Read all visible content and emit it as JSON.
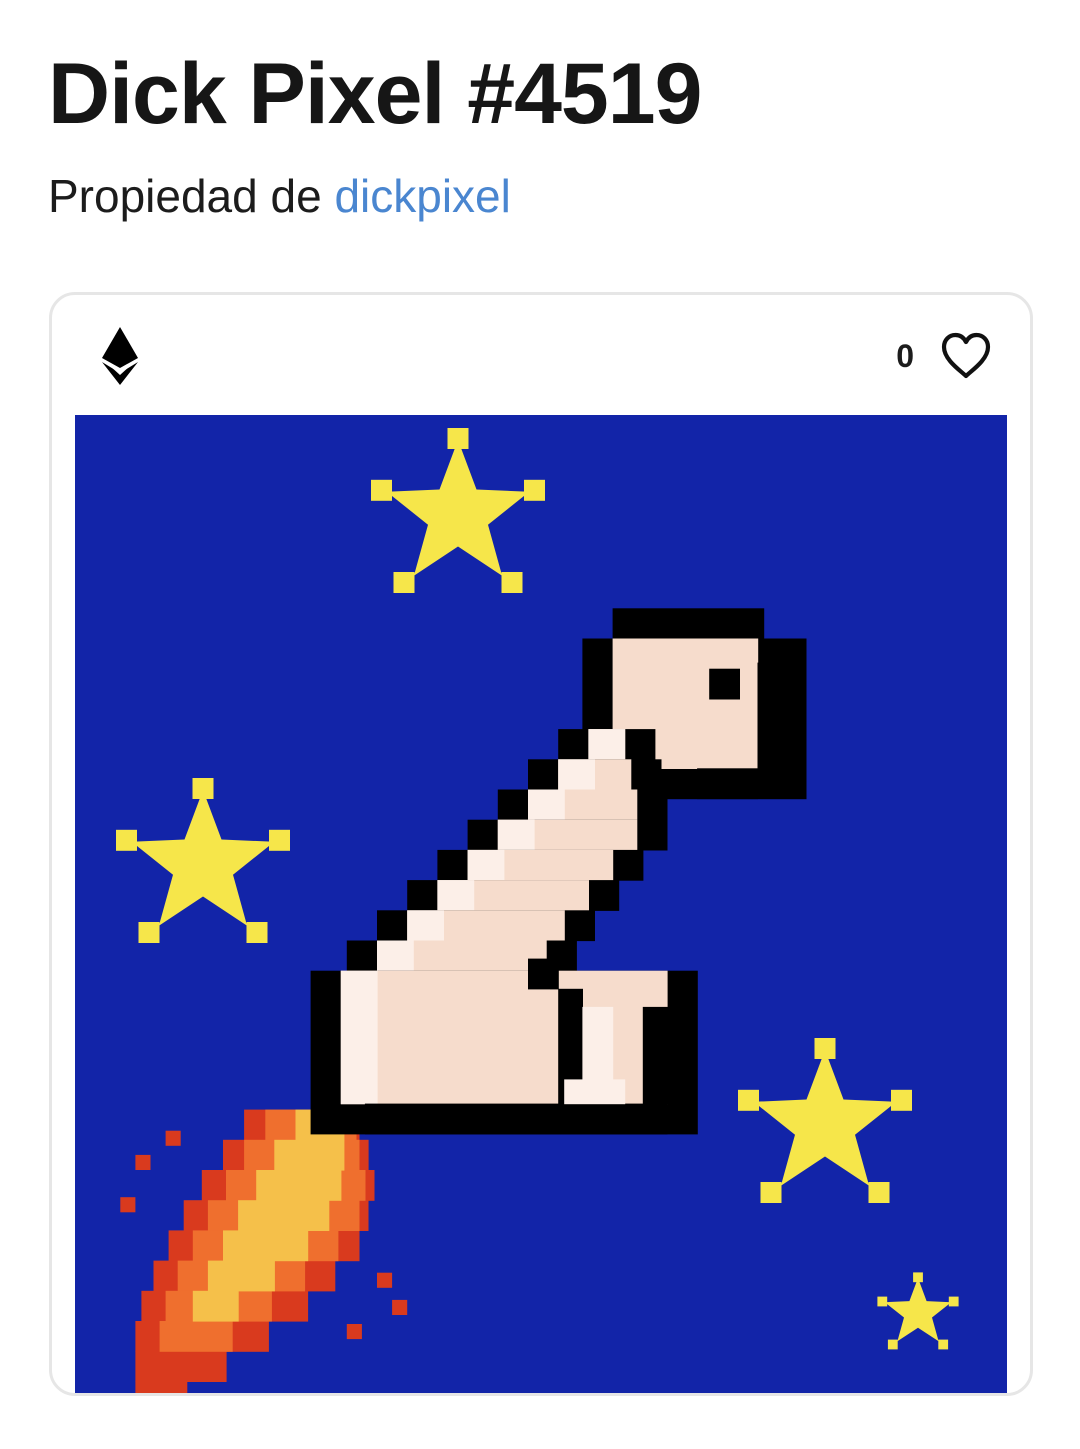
{
  "item": {
    "title": "Dick Pixel #4519",
    "owner_prefix": "Propiedad de ",
    "owner_name": "dickpixel"
  },
  "card": {
    "currency_icon": "ethereum-icon",
    "favorites_count": "0",
    "favorite_icon": "heart-outline-icon"
  },
  "artwork": {
    "background_color": "#1224a8",
    "star_color": "#f6e64a",
    "skin_color": "#f6dccc",
    "skin_highlight_color": "#fcefe8",
    "outline_color": "#000000",
    "flame_colors": [
      "#d93a1e",
      "#ef6f2e",
      "#f5c04a"
    ]
  },
  "colors": {
    "link": "#4a86d0",
    "title": "#161616",
    "card_border": "#e6e6e6"
  }
}
